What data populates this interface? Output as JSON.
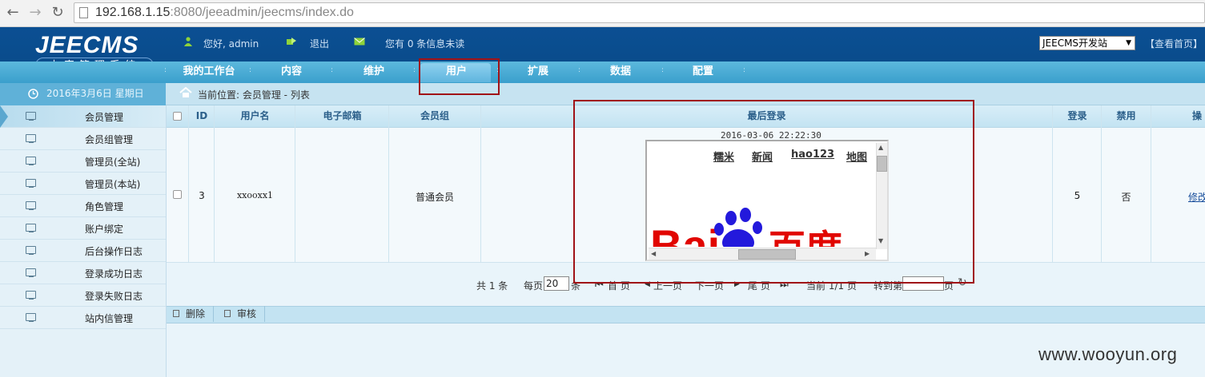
{
  "browser": {
    "url_host": "192.168.1.15",
    "url_rest": ":8080/jeeadmin/jeecms/index.do"
  },
  "header": {
    "logo_en": "JEECMS",
    "logo_cn": "内容管理系统",
    "greeting": "您好, admin",
    "logout": "退出",
    "messages": "您有 0 条信息未读",
    "site_select": "JEECMS开发站",
    "view_home": "【查看首页】"
  },
  "nav": {
    "items": [
      "我的工作台",
      "内容",
      "维护",
      "用户",
      "扩展",
      "数据",
      "配置"
    ],
    "active": "用户"
  },
  "subbar": {
    "date": "2016年3月6日 星期日",
    "breadcrumb": "当前位置: 会员管理 - 列表"
  },
  "sidebar": {
    "items": [
      "会员管理",
      "会员组管理",
      "管理员(全站)",
      "管理员(本站)",
      "角色管理",
      "账户绑定",
      "后台操作日志",
      "登录成功日志",
      "登录失败日志",
      "站内信管理"
    ],
    "active": "会员管理"
  },
  "table": {
    "headers": [
      "ID",
      "用户名",
      "电子邮箱",
      "会员组",
      "最后登录",
      "登录",
      "禁用",
      "操"
    ],
    "row": {
      "id": "3",
      "username": "xxooxx1",
      "email": "",
      "group": "普通会员",
      "last_login": "2016-03-06 22:22:30",
      "logins": "5",
      "disabled": "否",
      "action": "修改"
    }
  },
  "embedded_page": {
    "links": [
      "糯米",
      "新闻",
      "hao123",
      "地图"
    ],
    "logo_text": "Bai  百度"
  },
  "pagination": {
    "total": "共 1 条",
    "per_page_label": "每页",
    "per_page_value": "20",
    "per_page_unit": "条",
    "first": "首 页",
    "prev": "上一页",
    "next": "下一页",
    "last": "尾 页",
    "current": "当前 1/1 页",
    "goto_label": "转到第",
    "goto_unit": "页"
  },
  "toolbar": {
    "delete": "删除",
    "audit": "审核"
  },
  "watermark": "www.wooyun.org",
  "colors": {
    "header_bg": "#0b4f93",
    "nav_bg": "#3a9fcc",
    "annotation_red": "#a01217",
    "baidu_red": "#e10601",
    "baidu_blue": "#2319dc"
  }
}
